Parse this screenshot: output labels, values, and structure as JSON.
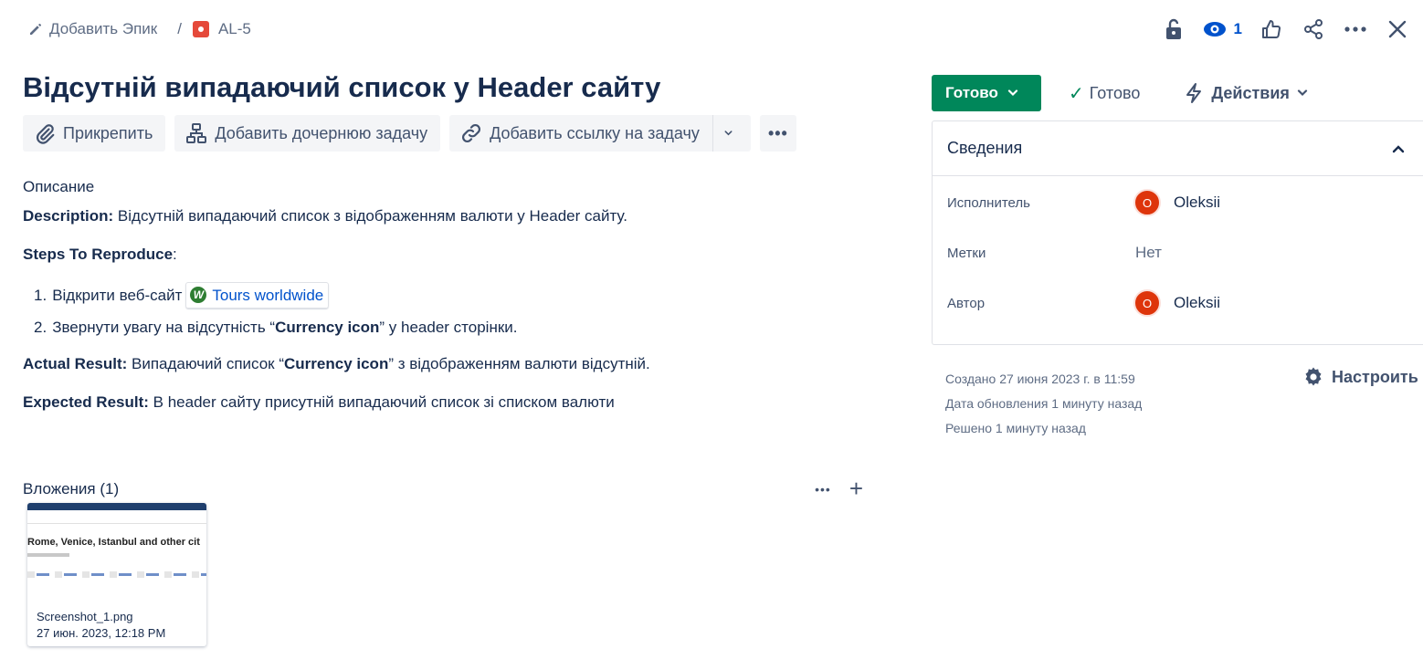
{
  "breadcrumb": {
    "epic_label": "Добавить Эпик",
    "separator": "/",
    "issue_key": "AL-5",
    "issue_type_color": "#e5493a"
  },
  "top_icons": {
    "lock": "lock-icon",
    "watch": "eye-icon",
    "watch_count": "1",
    "like": "thumbs-up-icon",
    "share": "share-icon",
    "more": "more-icon",
    "close": "close-icon"
  },
  "issue": {
    "title": "Відсутній випадаючий список у Header сайту"
  },
  "actions": {
    "attach_label": "Прикрепить",
    "child_label": "Добавить дочернюю задачу",
    "link_label": "Добавить ссылку на задачу",
    "more_label": "•••"
  },
  "description": {
    "heading": "Описание",
    "desc_label": "Description:",
    "desc_text": " Відсутній випадаючий список з відображенням валюти  у Header сайту.",
    "steps_label": "Steps To Reproduce",
    "steps_colon": ":",
    "steps": [
      {
        "num": "1.",
        "text": "Відкрити веб-сайт",
        "link": "Tours worldwide"
      },
      {
        "num": "2.",
        "pre": "Звернути увагу на відсутність “",
        "bold": "Currency icon",
        "post": "” у  header сторінки."
      }
    ],
    "actual_label": "Actual Result:",
    "actual_pre": " Випадаючий список “",
    "actual_bold": "Currency icon",
    "actual_post": "” з відображенням валюти відсутній.",
    "expected_label": "Expected Result:",
    "expected_text": " В header сайту присутній випадаючий список зі списком валюти"
  },
  "attachments": {
    "title": "Вложения (1)",
    "more": "•••",
    "add": "+",
    "items": [
      {
        "thumb_text": "Rome, Venice, Istanbul and other cit",
        "filename": "Screenshot_1.png",
        "date": "27 июн. 2023, 12:18 PM"
      }
    ]
  },
  "status": {
    "label": "Готово",
    "color": "#00875a",
    "resolution": "Готово",
    "actions_label": "Действия"
  },
  "details": {
    "title": "Сведения",
    "assignee_label": "Исполнитель",
    "assignee_name": "Oleksii",
    "assignee_initial": "O",
    "labels_label": "Метки",
    "labels_value": "Нет",
    "reporter_label": "Автор",
    "reporter_name": "Oleksii",
    "reporter_initial": "O",
    "avatar_color": "#de350b"
  },
  "dates": {
    "created": "Создано 27 июня 2023 г. в 11:59",
    "updated": "Дата обновления 1 минуту назад",
    "resolved": "Решено 1 минуту назад",
    "configure_label": "Настроить"
  }
}
